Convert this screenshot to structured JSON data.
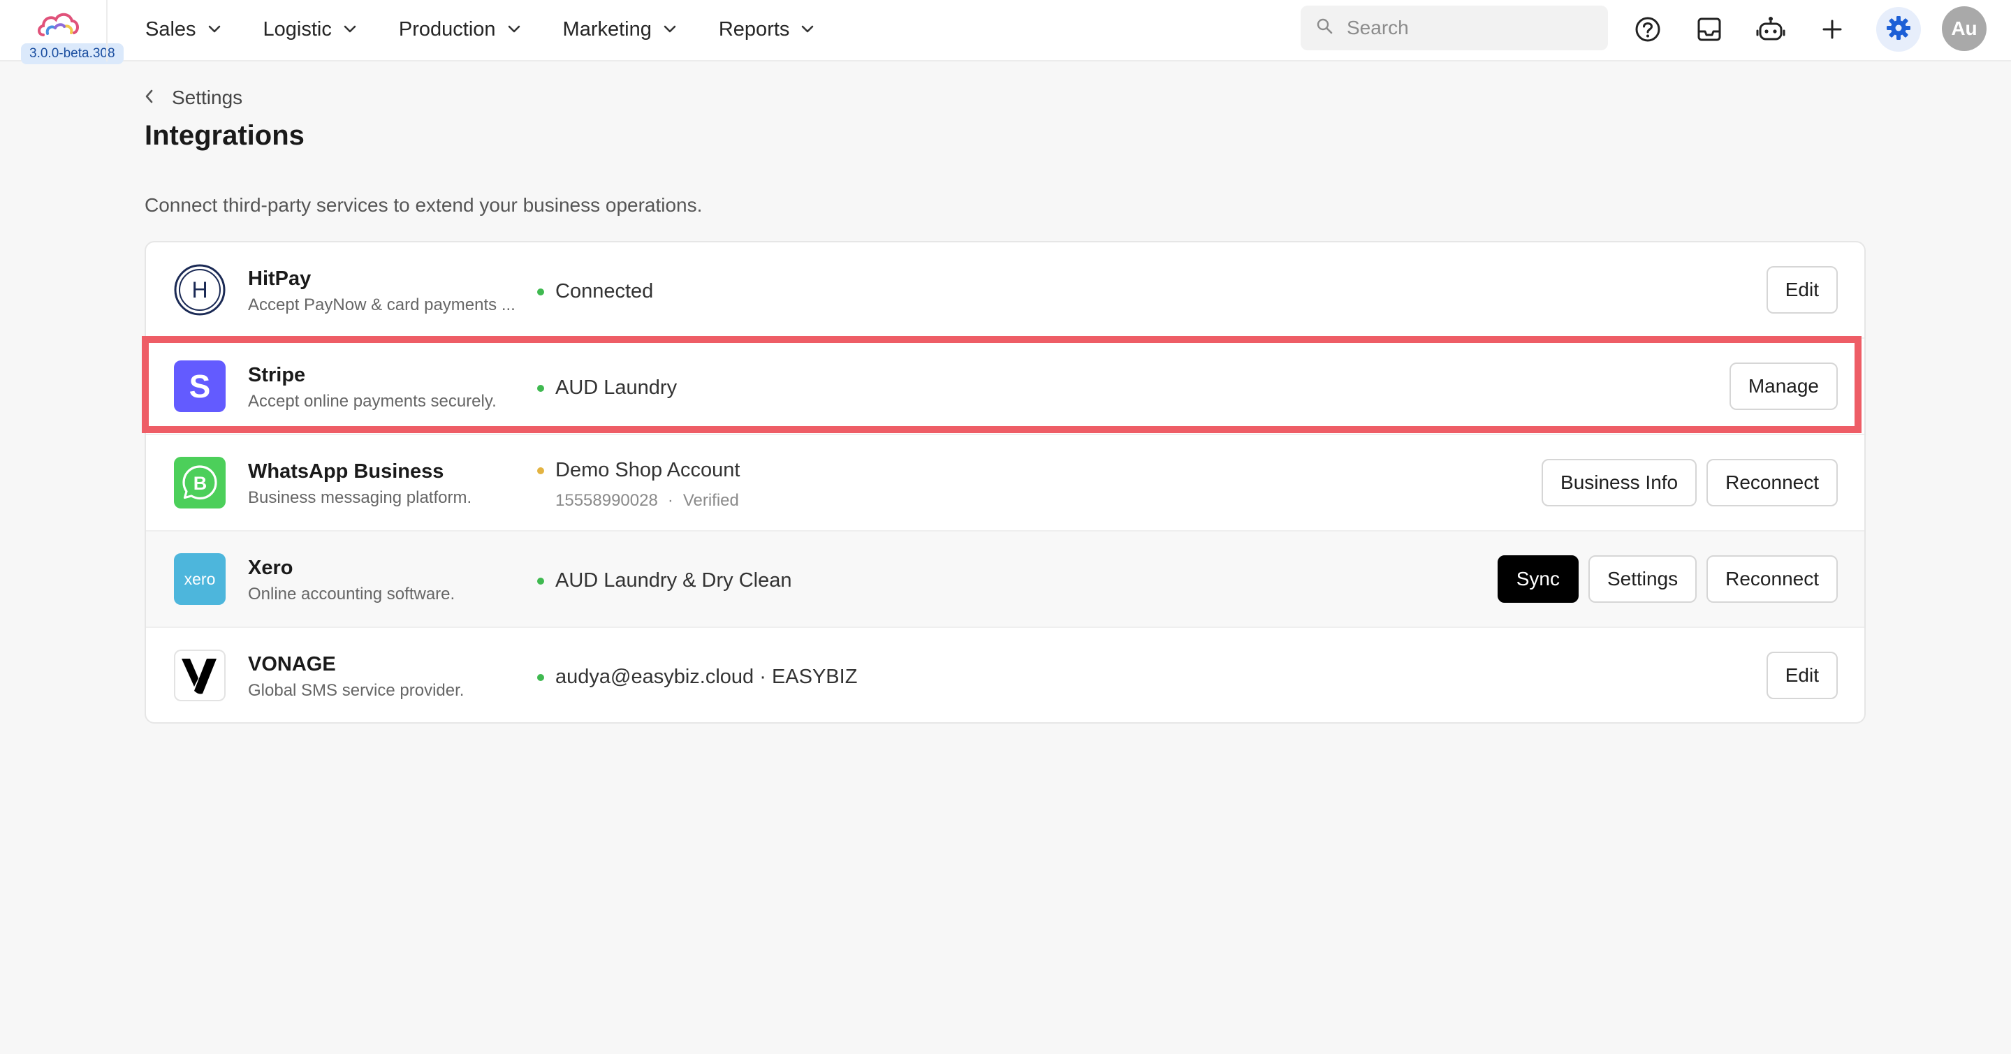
{
  "app": {
    "version": "3.0.0-beta.308"
  },
  "nav": {
    "items": [
      {
        "label": "Sales"
      },
      {
        "label": "Logistic"
      },
      {
        "label": "Production"
      },
      {
        "label": "Marketing"
      },
      {
        "label": "Reports"
      }
    ]
  },
  "search": {
    "placeholder": "Search",
    "value": ""
  },
  "toolbar": {
    "icons": [
      "help-icon",
      "inbox-icon",
      "robot-icon",
      "plus-icon",
      "gear-icon"
    ],
    "avatar_initials": "Au"
  },
  "page": {
    "breadcrumb": "Settings",
    "title": "Integrations",
    "description": "Connect third-party services to extend your business operations."
  },
  "integrations": [
    {
      "name": "HitPay",
      "description": "Accept PayNow & card payments ...",
      "status": "Connected",
      "status_color": "#3fb950",
      "actions": [
        "Edit"
      ]
    },
    {
      "name": "Stripe",
      "description": "Accept online payments securely.",
      "status": "AUD Laundry",
      "status_color": "#3fb950",
      "actions": [
        "Manage"
      ],
      "highlighted": true
    },
    {
      "name": "WhatsApp Business",
      "description": "Business messaging platform.",
      "status": "Demo Shop Account",
      "status_color": "#e3b341",
      "phone": "15558990028",
      "separator": "·",
      "verification": "Verified",
      "actions": [
        "Business Info",
        "Reconnect"
      ]
    },
    {
      "name": "Xero",
      "description": "Online accounting software.",
      "status": "AUD Laundry & Dry Clean",
      "status_color": "#3fb950",
      "actions": [
        "Sync",
        "Settings",
        "Reconnect"
      ]
    },
    {
      "name": "VONAGE",
      "description": "Global SMS service provider.",
      "status": "audya@easybiz.cloud · EASYBIZ",
      "status_color": "#3fb950",
      "actions": [
        "Edit"
      ]
    }
  ],
  "logos": {
    "hitpay_letter": "H",
    "stripe_letter": "S",
    "whatsapp_letter": "B",
    "xero_wordmark": "xero"
  },
  "colors": {
    "accent": "#1c5fd6",
    "highlight": "#ee5d66",
    "stripe": "#635bff",
    "whatsapp": "#4ccf5a",
    "xero": "#4db6dc"
  }
}
